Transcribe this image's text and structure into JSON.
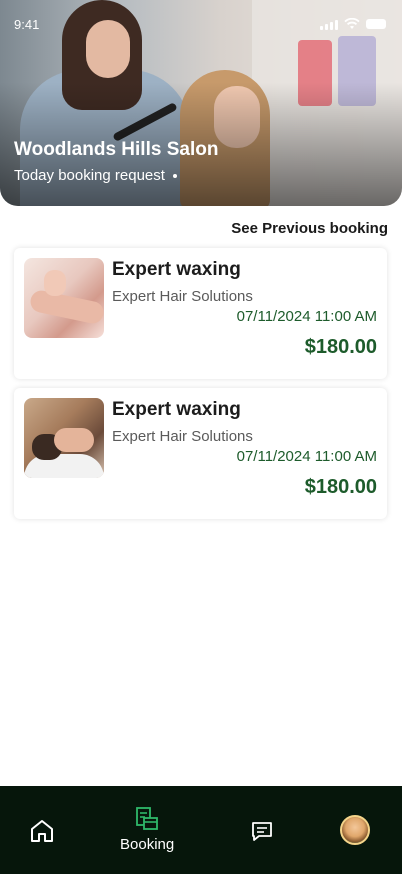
{
  "status_bar": {
    "time": "9:41"
  },
  "header": {
    "title": "Woodlands Hills Salon",
    "subtitle": "Today booking request"
  },
  "see_previous_label": "See Previous booking",
  "bookings": [
    {
      "service": "Expert waxing",
      "provider": "Expert Hair Solutions",
      "datetime": "07/11/2024 11:00 AM",
      "price": "$180.00",
      "image_icon": "waxing-photo"
    },
    {
      "service": "Expert waxing",
      "provider": "Expert Hair Solutions",
      "datetime": "07/11/2024 11:00 AM",
      "price": "$180.00",
      "image_icon": "hair-wash-photo"
    }
  ],
  "nav": {
    "booking_label": "Booking",
    "items": [
      "home-icon",
      "booking-icon",
      "chat-icon",
      "profile-avatar"
    ]
  },
  "colors": {
    "accent_green": "#1d5b2b",
    "nav_active": "#2fb86a",
    "nav_bg": "#06160b"
  }
}
